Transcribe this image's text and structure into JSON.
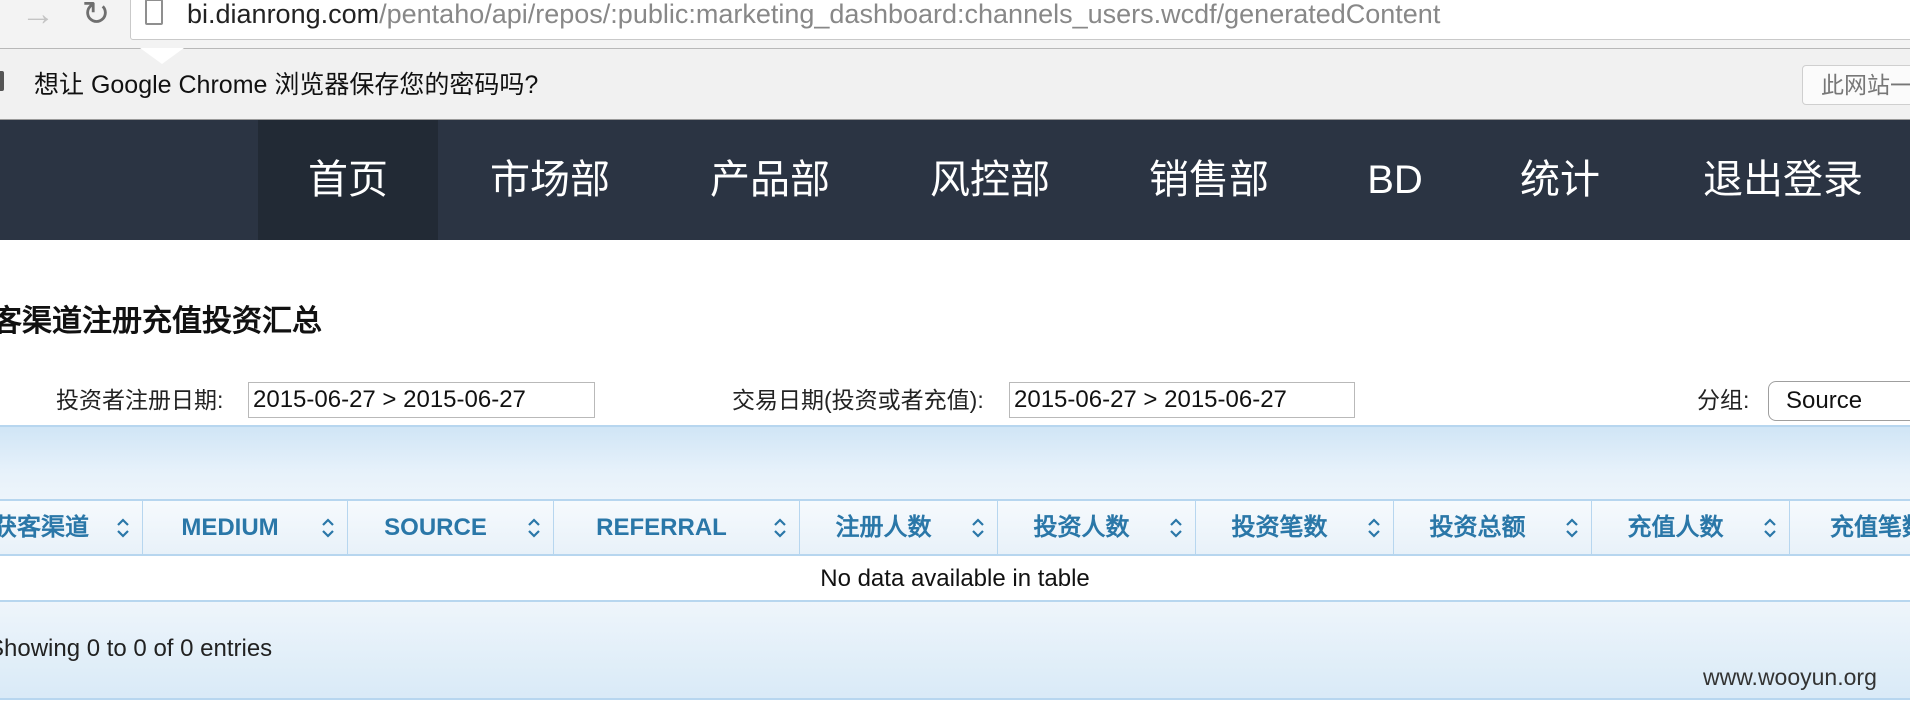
{
  "browser": {
    "url_host": "bi.dianrong.com",
    "url_path": "/pentaho/api/repos/:public:marketing_dashboard:channels_users.wcdf/generatedContent"
  },
  "infobar": {
    "message": "想让 Google Chrome 浏览器保存您的密码吗?",
    "button_label": "此网站一"
  },
  "nav": {
    "items": [
      {
        "label": "首页",
        "active": true
      },
      {
        "label": "市场部"
      },
      {
        "label": "产品部"
      },
      {
        "label": "风控部"
      },
      {
        "label": "销售部"
      },
      {
        "label": "BD"
      },
      {
        "label": "统计"
      },
      {
        "label": "退出登录"
      }
    ]
  },
  "dashboard": {
    "title": "客渠道注册充值投资汇总",
    "filters": {
      "register_date_label": "投资者注册日期:",
      "register_date_value": "2015-06-27 > 2015-06-27",
      "trade_date_label": "交易日期(投资或者充值):",
      "trade_date_value": "2015-06-27 > 2015-06-27",
      "group_label": "分组:",
      "group_value": "Source"
    },
    "table": {
      "columns": [
        "获客渠道",
        "MEDIUM",
        "SOURCE",
        "REFERRAL",
        "注册人数",
        "投资人数",
        "投资笔数",
        "投资总额",
        "充值人数",
        "充值笔数"
      ],
      "empty_message": "No data available in table",
      "info": "Showing 0 to 0 of 0 entries"
    }
  },
  "watermark": "www.wooyun.org",
  "colors": {
    "nav_bg": "#2b3443",
    "nav_active_bg": "#222a35",
    "header_text": "#2a77a8",
    "table_border": "#b7d6ef"
  }
}
